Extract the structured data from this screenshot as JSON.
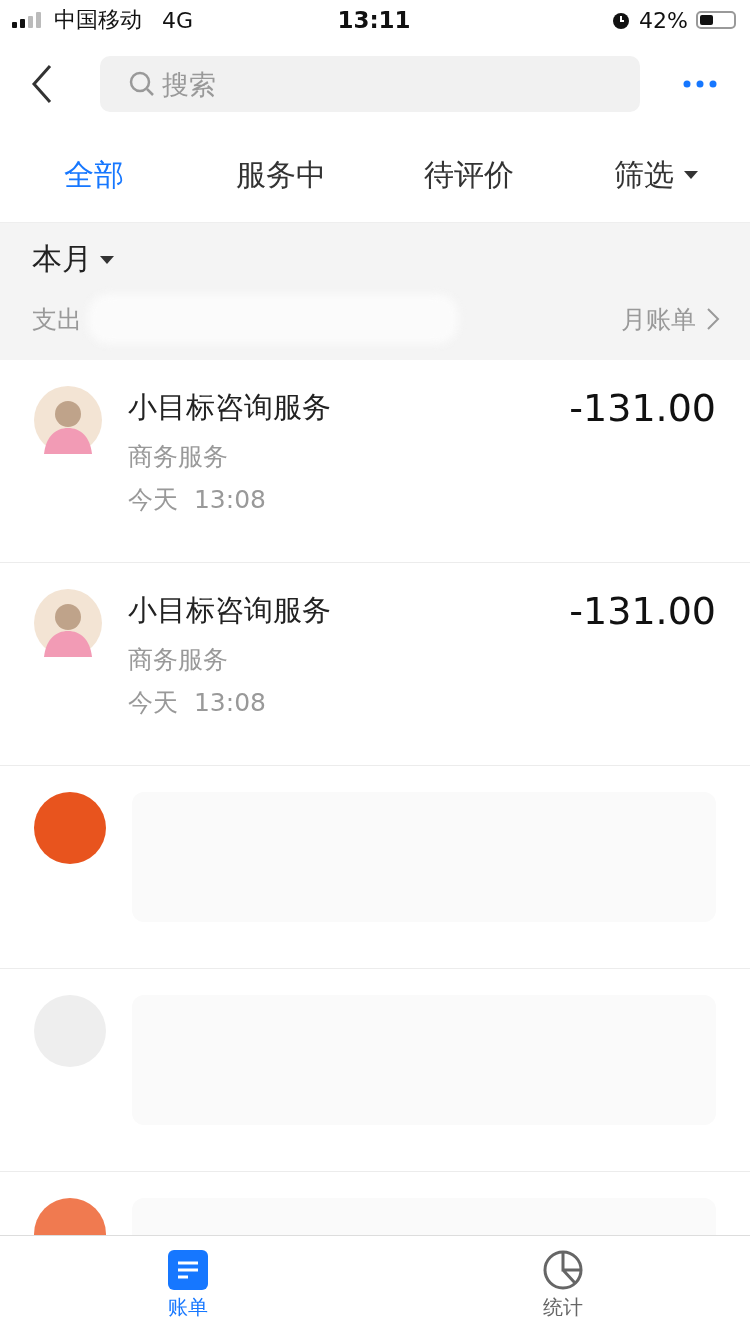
{
  "status_bar": {
    "carrier": "中国移动",
    "network": "4G",
    "time": "13:11",
    "battery": "42%"
  },
  "search": {
    "placeholder": "搜索"
  },
  "tabs": [
    {
      "label": "全部",
      "selected": true,
      "kind": "plain"
    },
    {
      "label": "服务中",
      "selected": false,
      "kind": "plain"
    },
    {
      "label": "待评价",
      "selected": false,
      "kind": "plain"
    },
    {
      "label": "筛选",
      "selected": false,
      "kind": "dropdown"
    }
  ],
  "summary": {
    "period": "本月",
    "expense_label": "支出",
    "monthly_bill": "月账单"
  },
  "transactions": [
    {
      "kind": "entry",
      "title": "小目标咨询服务",
      "category": "商务服务",
      "day": "今天",
      "time": "13:08",
      "amount": "-131.00"
    },
    {
      "kind": "entry",
      "title": "小目标咨询服务",
      "category": "商务服务",
      "day": "今天",
      "time": "13:08",
      "amount": "-131.00"
    },
    {
      "kind": "blurred",
      "color": "#e8541e"
    },
    {
      "kind": "blurred",
      "color": "#eeeeee"
    },
    {
      "kind": "blurred",
      "color": "#f07a50"
    }
  ],
  "bottom_tabs": [
    {
      "label": "账单",
      "selected": true,
      "kind": "list"
    },
    {
      "label": "统计",
      "selected": false,
      "kind": "pie"
    }
  ]
}
